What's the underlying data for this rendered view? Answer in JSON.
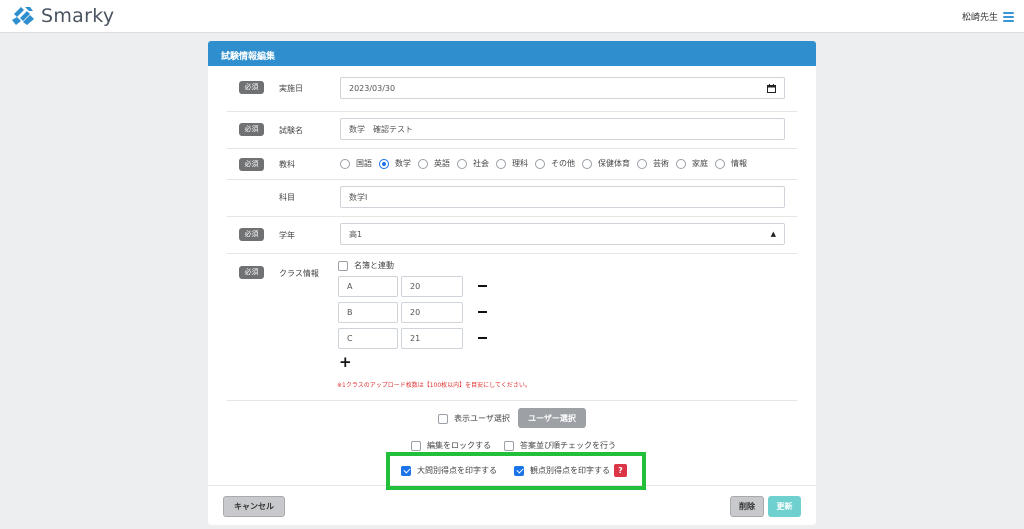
{
  "app": {
    "brand": "Smarky",
    "user_name": "松崎先生"
  },
  "card": {
    "title": "試験情報編集"
  },
  "form": {
    "required_badge": "必須",
    "date": {
      "label": "実施日",
      "value": "2023/03/30"
    },
    "exam_name": {
      "label": "試験名",
      "value": "数学　確認テスト"
    },
    "subject": {
      "label": "教科",
      "options": [
        "国語",
        "数学",
        "英語",
        "社会",
        "理科",
        "その他",
        "保健体育",
        "芸術",
        "家庭",
        "情報"
      ],
      "selected": "数学"
    },
    "course": {
      "label": "科目",
      "value": "数学Ⅰ"
    },
    "grade": {
      "label": "学年",
      "value": "高1"
    },
    "classes": {
      "label": "クラス情報",
      "link_roster_label": "名簿と連動",
      "rows": [
        {
          "name": "A",
          "count": "20"
        },
        {
          "name": "B",
          "count": "20"
        },
        {
          "name": "C",
          "count": "21"
        }
      ],
      "note": "※1クラスのアップロード枚数は【100枚以内】を目安にしてください。"
    }
  },
  "options": {
    "display_user_select_label": "表示ユーザ選択",
    "user_select_button": "ユーザー選択",
    "lock_edit_label": "編集をロックする",
    "answer_order_check_label": "答案並び順チェックを行う",
    "print_section_scores_label": "大問別得点を印字する",
    "print_section_scores_checked": true,
    "print_viewpoint_scores_label": "観点別得点を印字する",
    "print_viewpoint_scores_checked": true,
    "help_symbol": "?"
  },
  "footer": {
    "cancel_label": "キャンセル",
    "delete_label": "削除",
    "update_label": "更新"
  },
  "colors": {
    "accent": "#2f8fce",
    "highlight": "#22c03a",
    "update": "#6fd0d0",
    "danger": "#dc3545"
  }
}
